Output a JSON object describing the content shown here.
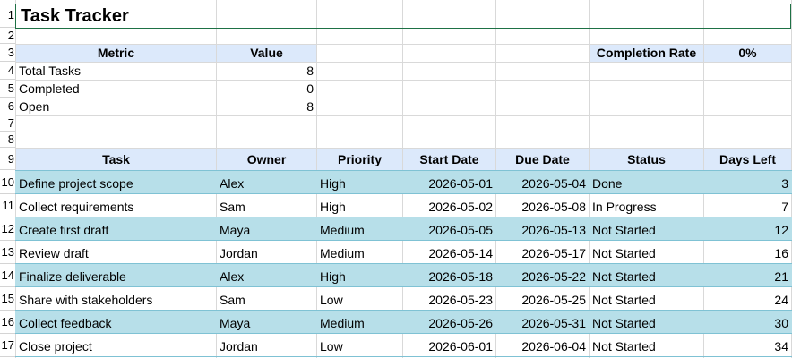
{
  "title": "Task Tracker",
  "row_numbers": [
    "1",
    "2",
    "3",
    "4",
    "5",
    "6",
    "7",
    "8",
    "9",
    "10",
    "11",
    "12",
    "13",
    "14",
    "15",
    "16",
    "17"
  ],
  "summary": {
    "metric_header": "Metric",
    "value_header": "Value",
    "rows": [
      {
        "metric": "Total Tasks",
        "value": "8"
      },
      {
        "metric": "Completed",
        "value": "0"
      },
      {
        "metric": "Open",
        "value": "8"
      }
    ],
    "completion_label": "Completion Rate",
    "completion_value": "0%"
  },
  "table": {
    "columns": [
      "Task",
      "Owner",
      "Priority",
      "Start Date",
      "Due Date",
      "Status",
      "Days Left"
    ],
    "rows": [
      {
        "task": "Define project scope",
        "owner": "Alex",
        "priority": "High",
        "start": "2026-05-01",
        "due": "2026-05-04",
        "status": "Done",
        "days": "3"
      },
      {
        "task": "Collect requirements",
        "owner": "Sam",
        "priority": "High",
        "start": "2026-05-02",
        "due": "2026-05-08",
        "status": "In Progress",
        "days": "7"
      },
      {
        "task": "Create first draft",
        "owner": "Maya",
        "priority": "Medium",
        "start": "2026-05-05",
        "due": "2026-05-13",
        "status": "Not Started",
        "days": "12"
      },
      {
        "task": "Review draft",
        "owner": "Jordan",
        "priority": "Medium",
        "start": "2026-05-14",
        "due": "2026-05-17",
        "status": "Not Started",
        "days": "16"
      },
      {
        "task": "Finalize deliverable",
        "owner": "Alex",
        "priority": "High",
        "start": "2026-05-18",
        "due": "2026-05-22",
        "status": "Not Started",
        "days": "21"
      },
      {
        "task": "Share with stakeholders",
        "owner": "Sam",
        "priority": "Low",
        "start": "2026-05-23",
        "due": "2026-05-25",
        "status": "Not Started",
        "days": "24"
      },
      {
        "task": "Collect feedback",
        "owner": "Maya",
        "priority": "Medium",
        "start": "2026-05-26",
        "due": "2026-05-31",
        "status": "Not Started",
        "days": "30"
      },
      {
        "task": "Close project",
        "owner": "Jordan",
        "priority": "Low",
        "start": "2026-06-01",
        "due": "2026-06-04",
        "status": "Not Started",
        "days": "34"
      }
    ]
  },
  "colors": {
    "header_fill": "#dce9fb",
    "band_fill": "#b7dfe9",
    "selection_border": "#1e7145"
  }
}
